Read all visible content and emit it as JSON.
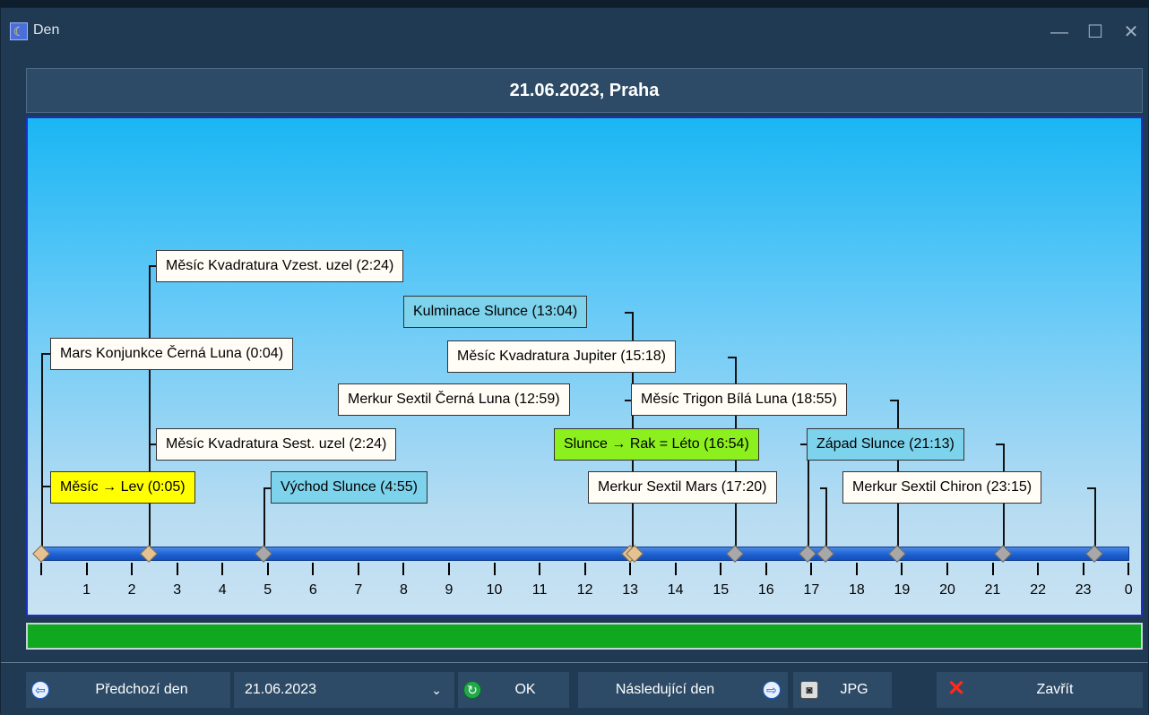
{
  "window": {
    "title": "Den"
  },
  "header": {
    "title": "21.06.2023, Praha"
  },
  "timeline": {
    "hour_labels": [
      "1",
      "2",
      "3",
      "4",
      "5",
      "6",
      "7",
      "8",
      "9",
      "10",
      "11",
      "12",
      "13",
      "14",
      "15",
      "16",
      "17",
      "18",
      "19",
      "20",
      "21",
      "22",
      "23",
      "0"
    ]
  },
  "events": [
    {
      "label": "Měsíc Kvadratura Vzest. uzel (2:24)",
      "style": "white"
    },
    {
      "label": "Kulminace Slunce (13:04)",
      "style": "blue"
    },
    {
      "label": "Mars Konjunkce Černá Luna (0:04)",
      "style": "white"
    },
    {
      "label": "Měsíc Kvadratura Jupiter (15:18)",
      "style": "white"
    },
    {
      "label": "Merkur Sextil Černá Luna (12:59)",
      "style": "white"
    },
    {
      "label": "Měsíc Trigon Bílá Luna (18:55)",
      "style": "white"
    },
    {
      "label": "Měsíc Kvadratura Sest. uzel (2:24)",
      "style": "white"
    },
    {
      "label": "Slunce → Rak = Léto (16:54)",
      "style": "lime"
    },
    {
      "label": "Západ Slunce (21:13)",
      "style": "blue"
    },
    {
      "label": "Měsíc → Lev (0:05)",
      "style": "yellow"
    },
    {
      "label": "Východ Slunce (4:55)",
      "style": "blue"
    },
    {
      "label": "Merkur Sextil Mars (17:20)",
      "style": "white"
    },
    {
      "label": "Merkur Sextil Chiron (23:15)",
      "style": "white"
    }
  ],
  "progress": {
    "value": 1.0,
    "color": "#10a81e"
  },
  "toolbar": {
    "prev_label": "Předchozí den",
    "date_value": "21.06.2023",
    "ok_label": "OK",
    "next_label": "Následující den",
    "jpg_label": "JPG",
    "close_label": "Zavřít"
  }
}
